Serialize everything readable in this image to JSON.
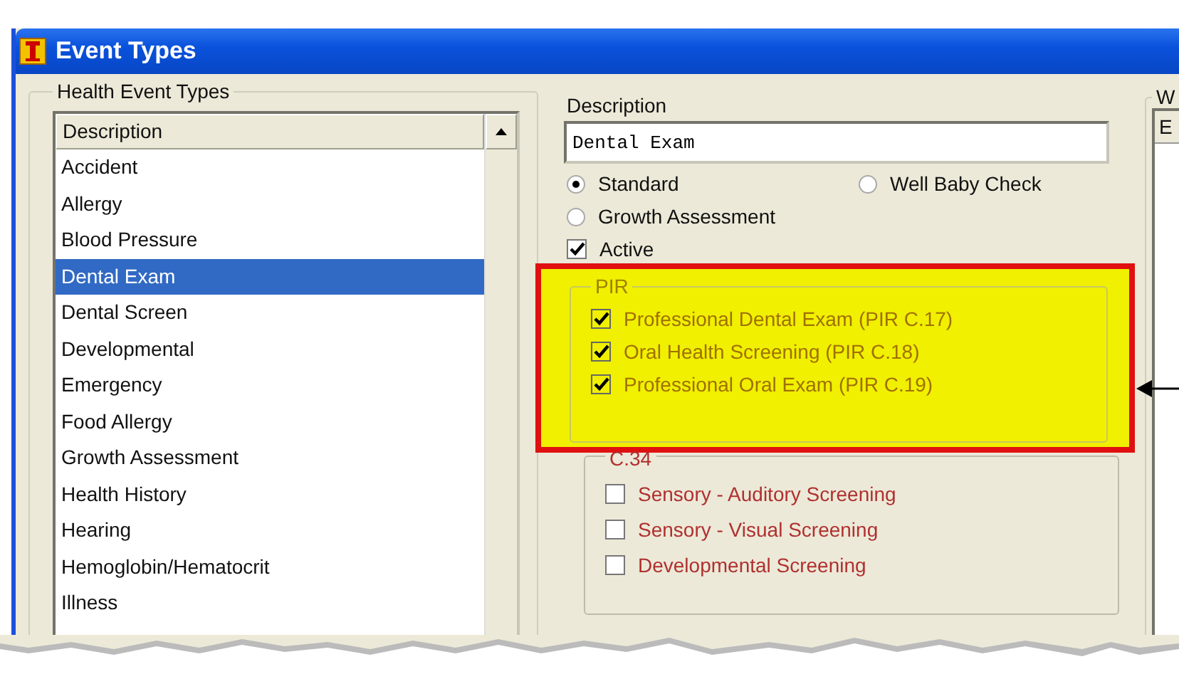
{
  "window": {
    "title": "Event Types"
  },
  "health_event_types": {
    "legend": "Health Event Types",
    "column": "Description",
    "items": [
      {
        "label": "Accident",
        "selected": false
      },
      {
        "label": "Allergy",
        "selected": false
      },
      {
        "label": "Blood Pressure",
        "selected": false
      },
      {
        "label": "Dental Exam",
        "selected": true
      },
      {
        "label": "Dental Screen",
        "selected": false
      },
      {
        "label": "Developmental",
        "selected": false
      },
      {
        "label": "Emergency",
        "selected": false
      },
      {
        "label": "Food Allergy",
        "selected": false
      },
      {
        "label": "Growth Assessment",
        "selected": false
      },
      {
        "label": "Health History",
        "selected": false
      },
      {
        "label": "Hearing",
        "selected": false
      },
      {
        "label": "Hemoglobin/Hematocrit",
        "selected": false
      },
      {
        "label": "Illness",
        "selected": false
      }
    ]
  },
  "details": {
    "description_label": "Description",
    "description_value": "Dental Exam",
    "options": [
      {
        "label": "Standard",
        "selected": true
      },
      {
        "label": "Well Baby Check",
        "selected": false
      },
      {
        "label": "Growth Assessment",
        "selected": false
      }
    ],
    "active": {
      "label": "Active",
      "checked": true
    },
    "pir": {
      "legend": "PIR",
      "items": [
        {
          "label": "Professional Dental Exam (PIR C.17)",
          "checked": true
        },
        {
          "label": "Oral Health Screening (PIR C.18)",
          "checked": true
        },
        {
          "label": "Professional Oral Exam (PIR C.19)",
          "checked": true
        }
      ]
    },
    "c34": {
      "legend": "C.34",
      "items": [
        {
          "label": "Sensory - Auditory Screening",
          "checked": false
        },
        {
          "label": "Sensory - Visual Screening",
          "checked": false
        },
        {
          "label": "Developmental Screening",
          "checked": false
        }
      ]
    }
  },
  "right_panel": {
    "legend": "W",
    "column": "E"
  }
}
